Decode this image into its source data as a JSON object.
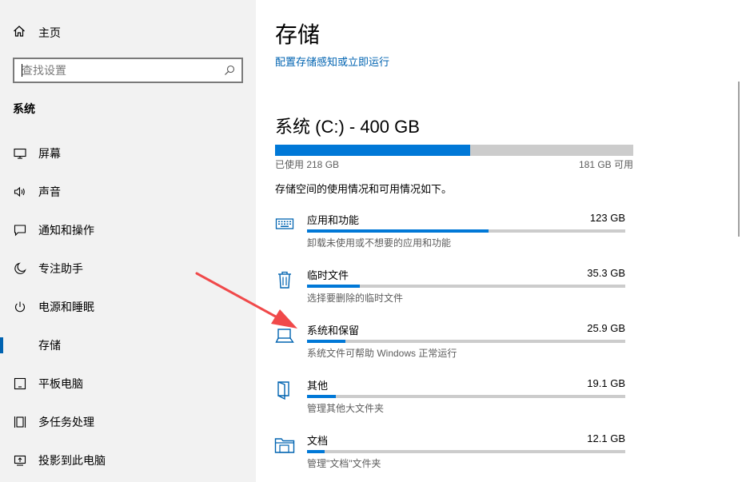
{
  "sidebar": {
    "home_label": "主页",
    "search_placeholder": "查找设置",
    "section_title": "系统",
    "items": [
      {
        "label": "屏幕",
        "icon": "monitor-icon"
      },
      {
        "label": "声音",
        "icon": "speaker-icon"
      },
      {
        "label": "通知和操作",
        "icon": "notification-icon"
      },
      {
        "label": "专注助手",
        "icon": "moon-icon"
      },
      {
        "label": "电源和睡眠",
        "icon": "power-icon"
      },
      {
        "label": "存储",
        "icon": "storage-icon",
        "selected": true
      },
      {
        "label": "平板电脑",
        "icon": "tablet-icon"
      },
      {
        "label": "多任务处理",
        "icon": "multitask-icon"
      },
      {
        "label": "投影到此电脑",
        "icon": "project-icon"
      }
    ]
  },
  "main": {
    "title": "存储",
    "link": "配置存储感知或立即运行",
    "drive": {
      "title": "系统 (C:) - 400 GB",
      "used": "已使用 218 GB",
      "free": "181 GB 可用",
      "used_fraction": 0.545
    },
    "description": "存储空间的使用情况和可用情况如下。",
    "categories": [
      {
        "name": "应用和功能",
        "size": "123 GB",
        "desc": "卸载未使用或不想要的应用和功能",
        "fraction": 0.57,
        "icon": "keyboard-icon"
      },
      {
        "name": "临时文件",
        "size": "35.3 GB",
        "desc": "选择要删除的临时文件",
        "fraction": 0.165,
        "icon": "trash-icon"
      },
      {
        "name": "系统和保留",
        "size": "25.9 GB",
        "desc": "系统文件可帮助 Windows 正常运行",
        "fraction": 0.12,
        "icon": "laptop-icon"
      },
      {
        "name": "其他",
        "size": "19.1 GB",
        "desc": "管理其他大文件夹",
        "fraction": 0.09,
        "icon": "folder-open-icon"
      },
      {
        "name": "文档",
        "size": "12.1 GB",
        "desc": "管理\"文档\"文件夹",
        "fraction": 0.055,
        "icon": "documents-folder-icon"
      }
    ]
  },
  "colors": {
    "accent": "#0078d7",
    "link": "#0063b1",
    "arrow": "#f0494a"
  }
}
